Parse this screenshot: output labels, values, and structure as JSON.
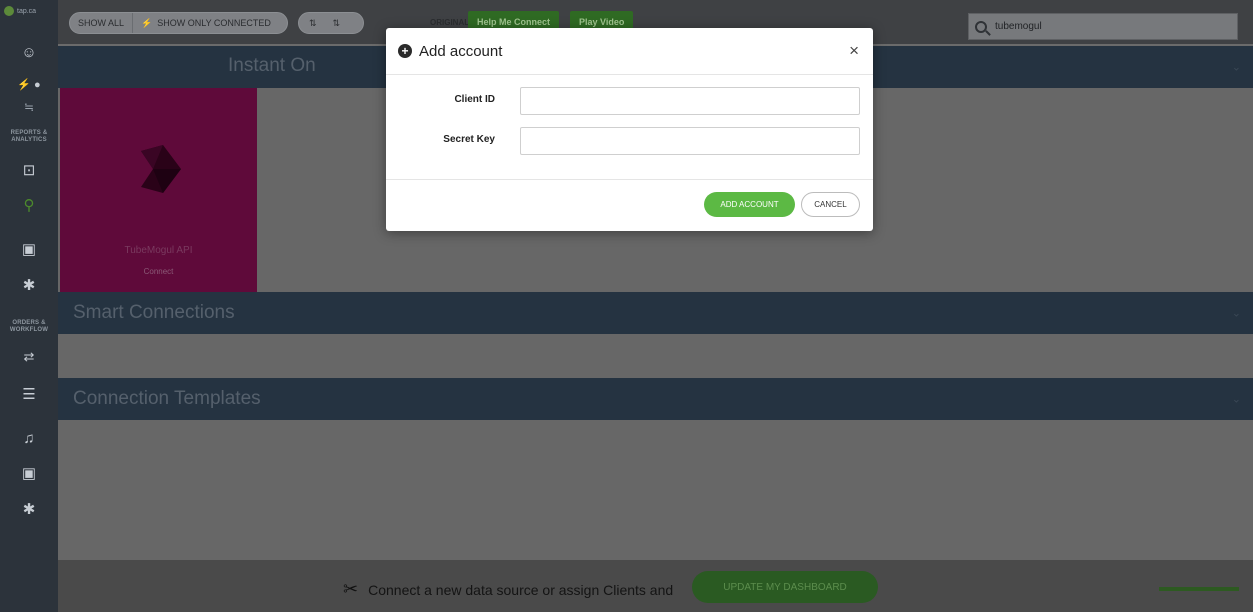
{
  "app": {
    "logo_text": "tap.ca"
  },
  "sidebar": {
    "section_reports": "REPORTS & ANALYTICS",
    "section_orders": "ORDERS & WORKFLOW"
  },
  "toolbar": {
    "show_all": "SHOW ALL",
    "show_only_connected": "SHOW ONLY CONNECTED",
    "original_order": "ORIGINAL ORDER",
    "help_me_connect": "Help Me Connect",
    "play_video": "Play Video"
  },
  "search": {
    "value": "tubemogul"
  },
  "sections": {
    "instant_on": "Instant On",
    "smart_connections": "Smart Connections",
    "connection_templates": "Connection Templates"
  },
  "tile": {
    "title": "TubeMogul API",
    "connect_label": "Connect",
    "color": "#5f0a3a"
  },
  "bottom": {
    "message": "Connect a new data source or assign Clients and",
    "update_button": "UPDATE MY DASHBOARD"
  },
  "modal": {
    "title": "Add account",
    "close_glyph": "×",
    "client_id_label": "Client ID",
    "client_id_value": "",
    "secret_key_label": "Secret Key",
    "secret_key_value": "",
    "add_button": "ADD ACCOUNT",
    "cancel_button": "CANCEL",
    "accent_color": "#5cb944"
  }
}
